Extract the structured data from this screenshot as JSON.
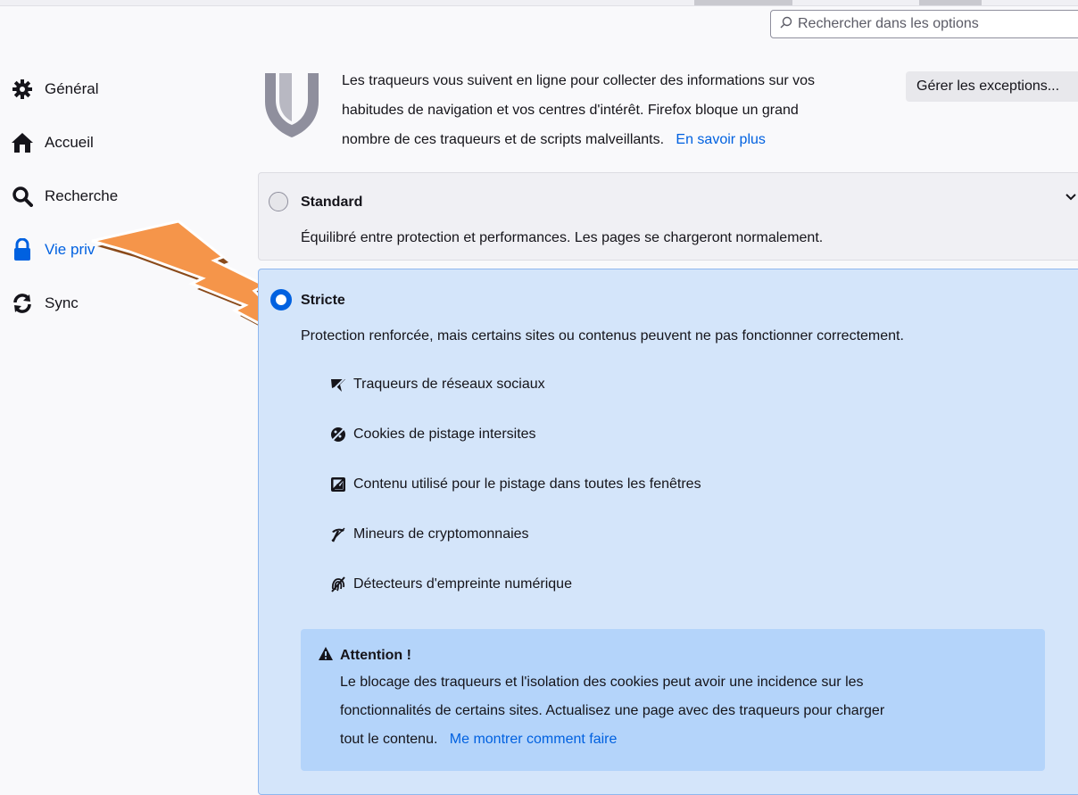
{
  "search": {
    "placeholder": "Rechercher dans les options"
  },
  "sidebar": {
    "items": [
      {
        "label": "Général",
        "icon": "gear-icon"
      },
      {
        "label": "Accueil",
        "icon": "home-icon"
      },
      {
        "label": "Recherche",
        "icon": "search-icon"
      },
      {
        "label": "Vie priv",
        "icon": "lock-icon",
        "active": true
      },
      {
        "label": "Sync",
        "icon": "sync-icon"
      }
    ]
  },
  "intro": {
    "line1": "Les traqueurs vous suivent en ligne pour collecter des informations sur vos",
    "line2": "habitudes de navigation et vos centres d'intérêt. Firefox bloque un grand",
    "line3": "nombre de ces traqueurs et de scripts malveillants.",
    "learn_more": "En savoir plus",
    "exceptions_button": "Gérer les exceptions..."
  },
  "standard": {
    "title": "Standard",
    "description": "Équilibré entre protection et performances. Les pages se chargeront normalement."
  },
  "strict": {
    "title": "Stricte",
    "description": "Protection renforcée, mais certains sites ou contenus peuvent ne pas fonctionner correctement.",
    "features": [
      {
        "label": "Traqueurs de réseaux sociaux",
        "icon": "social-tracker-icon"
      },
      {
        "label": "Cookies de pistage intersites",
        "icon": "cookie-icon"
      },
      {
        "label": "Contenu utilisé pour le pistage dans toutes les fenêtres",
        "icon": "tracking-content-icon"
      },
      {
        "label": "Mineurs de cryptomonnaies",
        "icon": "cryptominer-icon"
      },
      {
        "label": "Détecteurs d'empreinte numérique",
        "icon": "fingerprinter-icon"
      }
    ],
    "warning": {
      "title": "Attention !",
      "line1": "Le blocage des traqueurs et l'isolation des cookies peut avoir une incidence sur les",
      "line2": "fonctionnalités de certains sites. Actualisez une page avec des traqueurs pour charger",
      "line3": "tout le contenu.",
      "link": "Me montrer comment faire"
    }
  },
  "colors": {
    "accent": "#0061e0",
    "selected_bg": "#d4e5fa",
    "warning_bg": "#b4d4fa",
    "bolt": "#f5954a"
  }
}
